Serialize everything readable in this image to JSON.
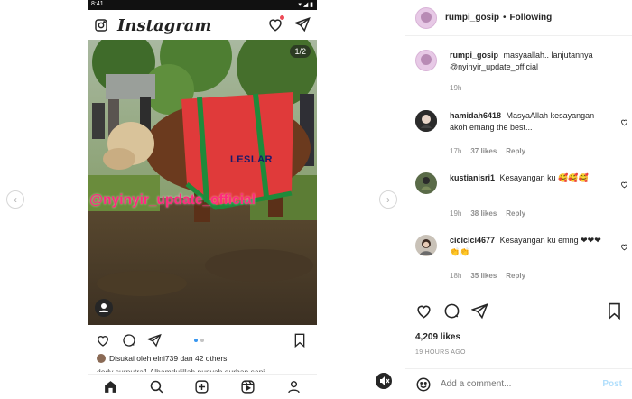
{
  "phone": {
    "status_time": "8:41",
    "app_title": "Instagram",
    "counter": "1/2",
    "watermark": "@nyinyir_update_official",
    "cloth_text": "LESLAR",
    "liked_by": "Disukai oleh elni739 dan 42 others",
    "caption_peek": "dedy surputra1 Alhamdulillah punyah qurban sapi"
  },
  "post": {
    "username": "rumpi_gosip",
    "separator": "•",
    "follow_status": "Following",
    "caption_text": "masyaallah.. lanjutannya @nyinyir_update_official",
    "caption_time": "19h",
    "likes": "4,209 likes",
    "time_ago": "19 HOURS AGO"
  },
  "comments": [
    {
      "user": "hamidah6418",
      "text": "MasyaAllah kesayangan akoh emang the best...",
      "time": "17h",
      "likes": "37 likes",
      "reply": "Reply"
    },
    {
      "user": "kustianisri1",
      "text": "Kesayangan ku 🥰🥰🥰",
      "time": "19h",
      "likes": "38 likes",
      "reply": "Reply"
    },
    {
      "user": "cicicici4677",
      "text": "Kesayangan ku emng ❤❤❤👏👏",
      "time": "18h",
      "likes": "35 likes",
      "reply": "Reply"
    }
  ],
  "comment_box": {
    "placeholder": "Add a comment...",
    "post_label": "Post"
  },
  "colors": {
    "accent_blue": "#0095f6",
    "watermark_pink": "#ff2a7f",
    "cloth_red": "#e03a3a",
    "cloth_trim": "#1f8a3a"
  },
  "icons": [
    "camera-icon",
    "heart-icon",
    "send-icon",
    "comment-icon",
    "share-icon",
    "bookmark-icon",
    "home-icon",
    "search-icon",
    "add-icon",
    "reels-icon",
    "profile-icon",
    "emoji-icon",
    "mute-icon",
    "chevron-left-icon",
    "chevron-right-icon",
    "user-tag-icon"
  ]
}
